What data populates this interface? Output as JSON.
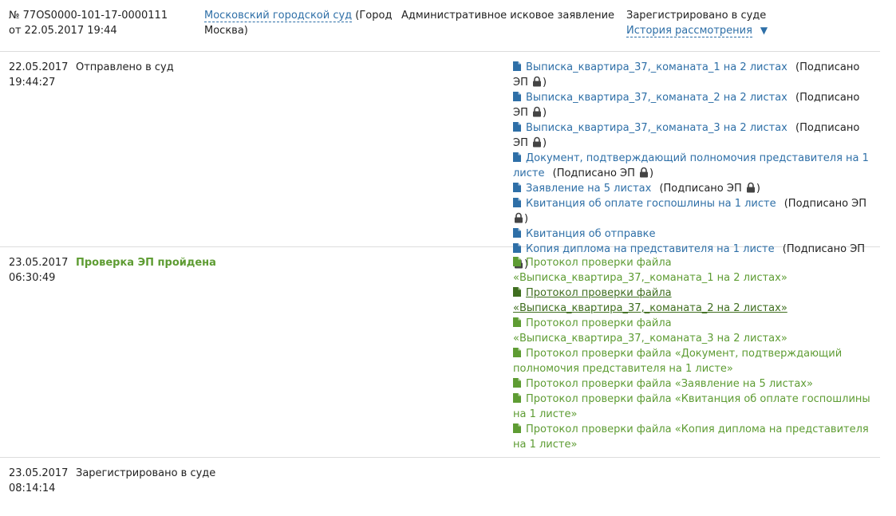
{
  "header": {
    "case_number": "№ 77OS0000-101-17-0000111",
    "case_date": "от 22.05.2017 19:44",
    "court_link": "Московский городской суд",
    "court_city": " (Город Москва)",
    "case_type": "Административное исковое заявление",
    "status": "Зарегистрировано в суде",
    "history_link": "История рассмотрения"
  },
  "sig_open": "(Подписано ЭП ",
  "sig_close": ")",
  "events": [
    {
      "date": "22.05.2017",
      "time": "19:44:27",
      "title": "Отправлено в суд",
      "docs": [
        {
          "name": "Выписка_квартира_37,_команата_1 на 2 листах"
        },
        {
          "name": "Выписка_квартира_37,_команата_2 на 2 листах"
        },
        {
          "name": "Выписка_квартира_37,_команата_3 на 2 листах"
        },
        {
          "name": "Документ, подтверждающий полномочия представителя на 1 листе"
        },
        {
          "name": "Заявление на 5 листах"
        },
        {
          "name": "Квитанция об оплате госпошлины на 1 листе"
        },
        {
          "name": "Квитанция об отправке"
        },
        {
          "name": "Копия диплома на представителя на 1 листе"
        }
      ]
    },
    {
      "date": "23.05.2017",
      "time": "06:30:49",
      "title": "Проверка ЭП пройдена",
      "docs": [
        {
          "name": "Протокол проверки файла «Выписка_квартира_37,_команата_1 на 2 листах»"
        },
        {
          "name": "Протокол проверки файла «Выписка_квартира_37,_команата_2 на 2 листах»"
        },
        {
          "name": "Протокол проверки файла «Выписка_квартира_37,_команата_3 на 2 листах»"
        },
        {
          "name": "Протокол проверки файла «Документ, подтверждающий полномочия представителя на 1 листе»"
        },
        {
          "name": "Протокол проверки файла «Заявление на 5 листах»"
        },
        {
          "name": "Протокол проверки файла «Квитанция об оплате госпошлины на 1 листе»"
        },
        {
          "name": "Протокол проверки файла «Копия диплома на представителя на 1 листе»"
        }
      ]
    },
    {
      "date": "23.05.2017",
      "time": "08:14:14",
      "title": "Зарегистрировано в суде"
    }
  ],
  "colors": {
    "link": "#2e6fa7",
    "green": "#5e9c33",
    "text": "#222222",
    "divider": "#dcdcdc"
  }
}
